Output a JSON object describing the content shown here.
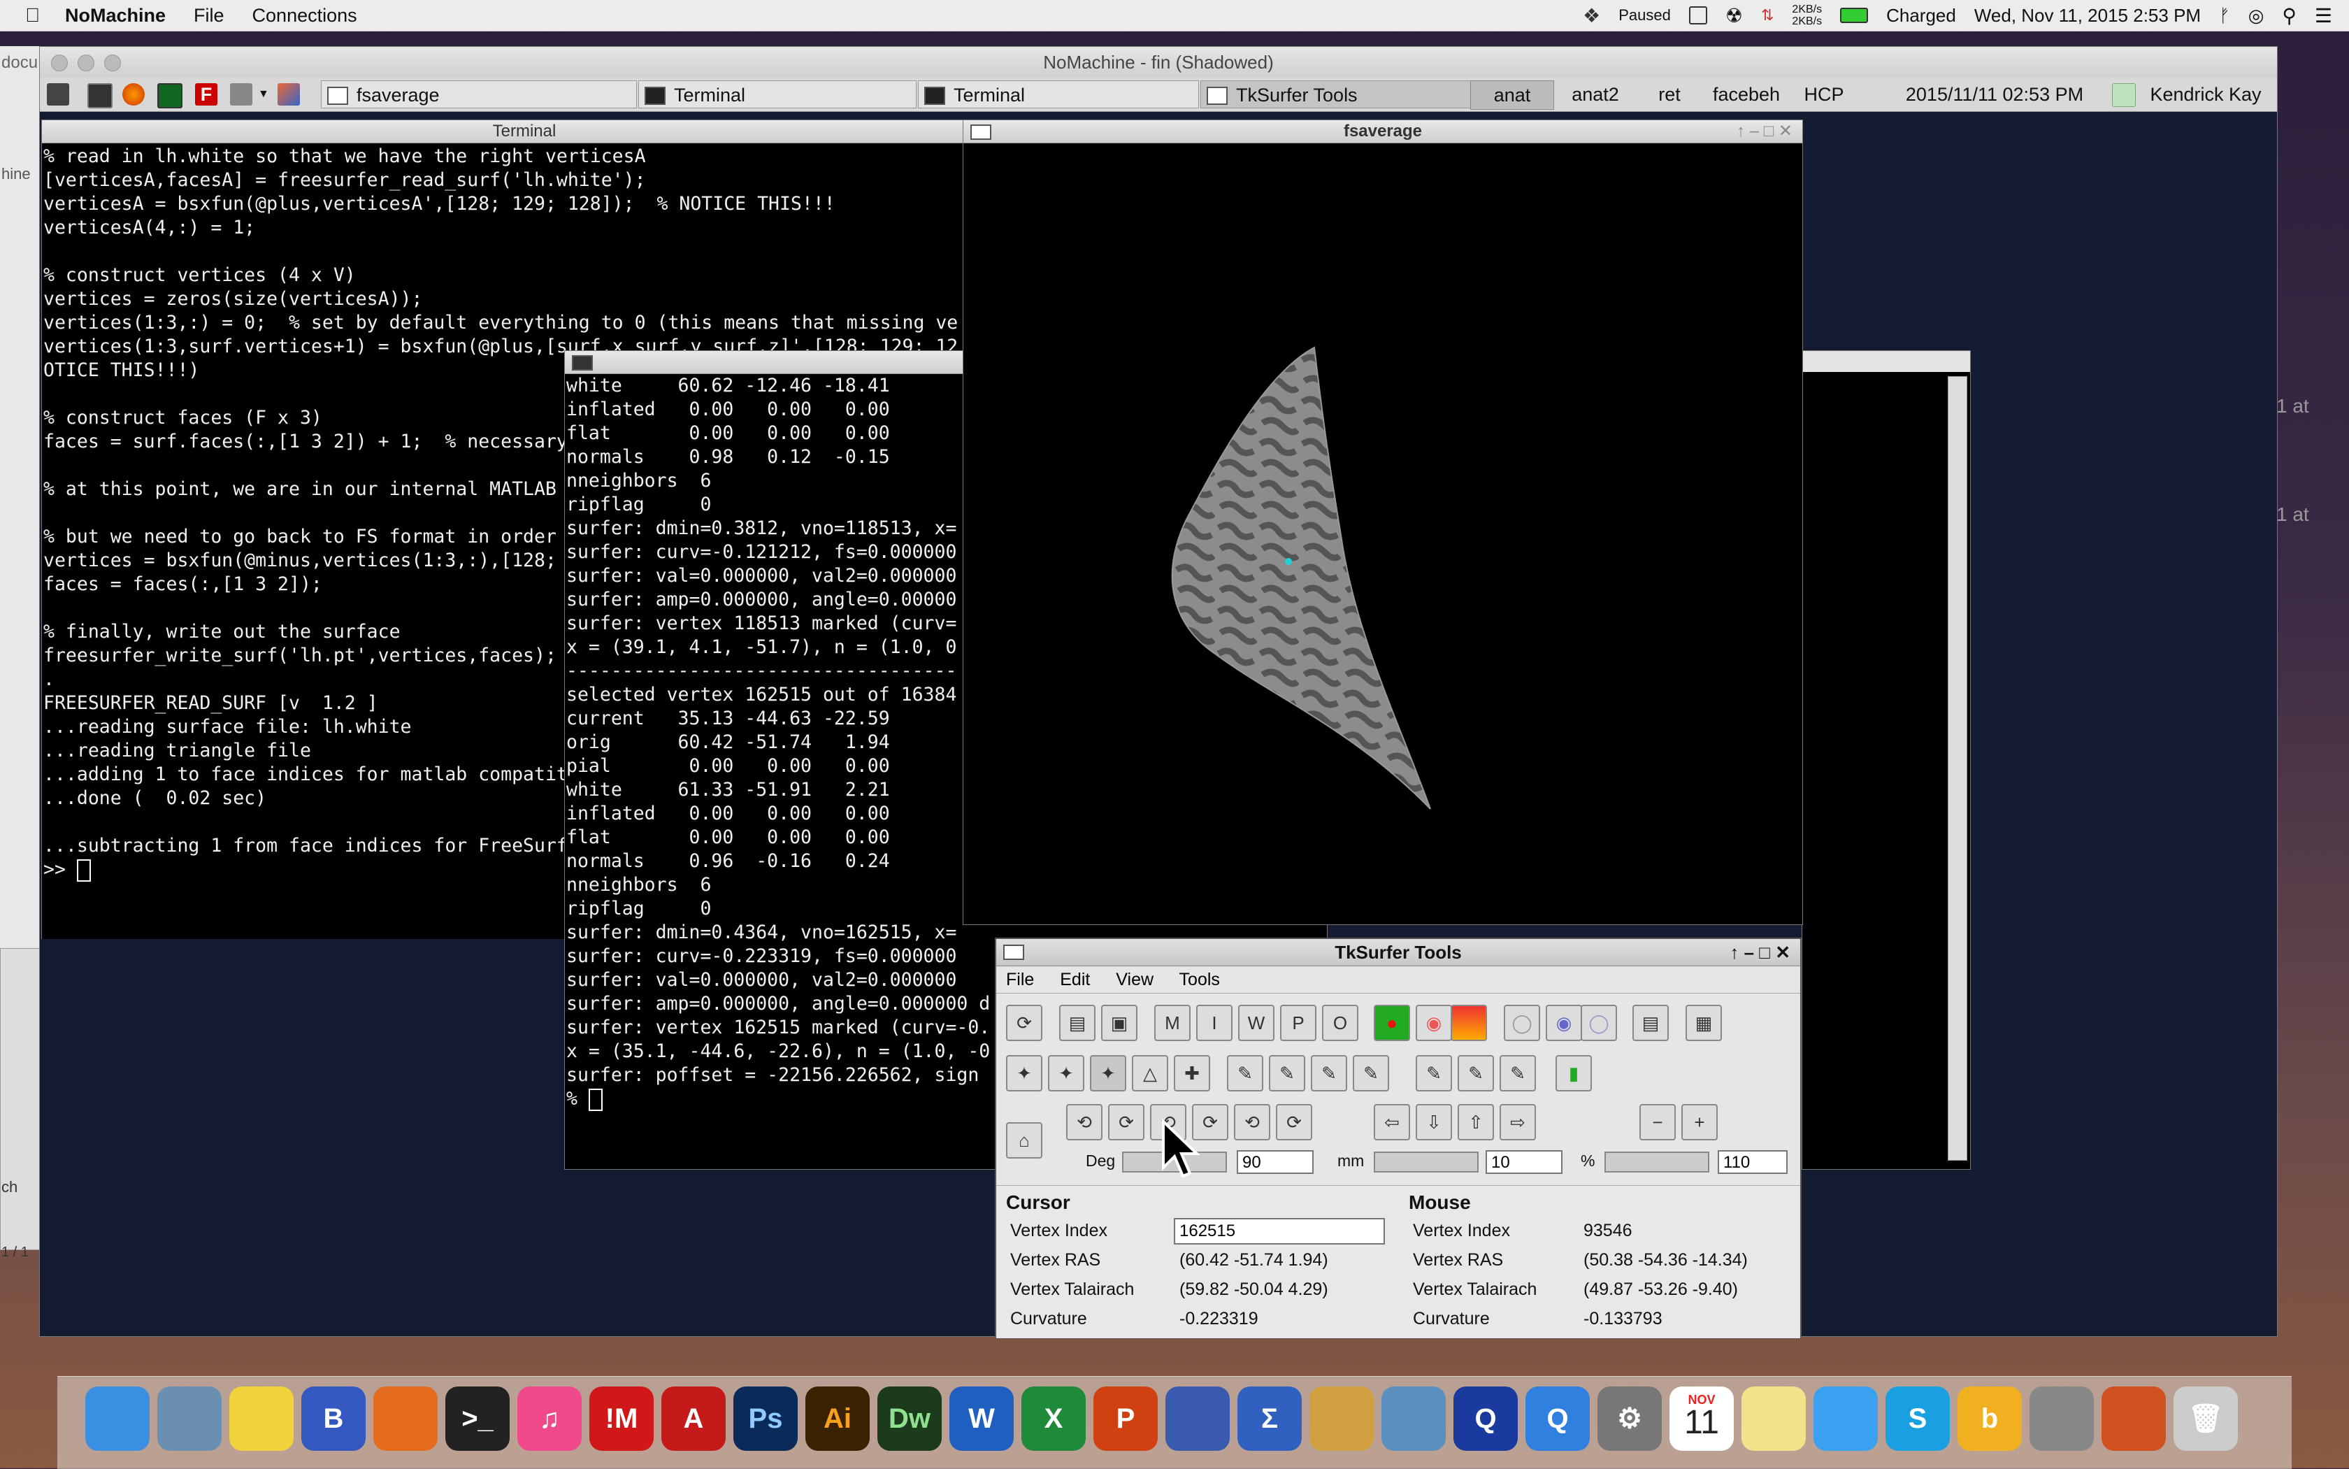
{
  "menubar": {
    "app": "NoMachine",
    "items": [
      "File",
      "Connections"
    ],
    "status_paused": "Paused",
    "net_up": "2KB/s",
    "net_down": "2KB/s",
    "battery": "Charged",
    "datetime": "Wed, Nov 11, 2015  2:53 PM"
  },
  "nomachine": {
    "title": "NoMachine - fin (Shadowed)",
    "taskbar": {
      "tasks": [
        "fsaverage",
        "Terminal",
        "Terminal",
        "TkSurfer Tools"
      ],
      "workspaces": [
        "anat",
        "anat2",
        "ret",
        "facebeh",
        "HCP"
      ],
      "clock": "2015/11/11  02:53 PM",
      "user": "Kendrick Kay"
    }
  },
  "terminal1": {
    "title": "Terminal",
    "lines": [
      "% read in lh.white so that we have the right verticesA",
      "[verticesA,facesA] = freesurfer_read_surf('lh.white');",
      "verticesA = bsxfun(@plus,verticesA',[128; 129; 128]);  % NOTICE THIS!!!",
      "verticesA(4,:) = 1;",
      "",
      "% construct vertices (4 x V)",
      "vertices = zeros(size(verticesA));",
      "vertices(1:3,:) = 0;  % set by default everything to 0 (this means that missing ve",
      "vertices(1:3,surf.vertices+1) = bsxfun(@plus,[surf.x surf.y surf.z]',[128; 129; 12",
      "OTICE THIS!!!)",
      "",
      "% construct faces (F x 3)",
      "faces = surf.faces(:,[1 3 2]) + 1;  % necessary",
      "",
      "% at this point, we are in our internal MATLAB",
      "",
      "% but we need to go back to FS format in order",
      "vertices = bsxfun(@minus,vertices(1:3,:),[128;",
      "faces = faces(:,[1 3 2]);",
      "",
      "% finally, write out the surface",
      "freesurfer_write_surf('lh.pt',vertices,faces);",
      ".",
      "FREESURFER_READ_SURF [v  1.2 ]",
      "...reading surface file: lh.white",
      "...reading triangle file",
      "...adding 1 to face indices for matlab compatit",
      "...done (  0.02 sec)",
      "",
      "...subtracting 1 from face indices for FreeSurf",
      ">> "
    ]
  },
  "terminal2": {
    "lines": [
      "white     60.62 -12.46 -18.41",
      "inflated   0.00   0.00   0.00",
      "flat       0.00   0.00   0.00",
      "normals    0.98   0.12  -0.15",
      "nneighbors  6",
      "ripflag     0",
      "surfer: dmin=0.3812, vno=118513, x=",
      "surfer: curv=-0.121212, fs=0.000000",
      "surfer: val=0.000000, val2=0.000000",
      "surfer: amp=0.000000, angle=0.00000",
      "surfer: vertex 118513 marked (curv=",
      "x = (39.1, 4.1, -51.7), n = (1.0, 0",
      "-----------------------------------",
      "selected vertex 162515 out of 16384",
      "current   35.13 -44.63 -22.59",
      "orig      60.42 -51.74   1.94",
      "pial       0.00   0.00   0.00",
      "white     61.33 -51.91   2.21",
      "inflated   0.00   0.00   0.00",
      "flat       0.00   0.00   0.00",
      "normals    0.96  -0.16   0.24",
      "nneighbors  6",
      "ripflag     0",
      "surfer: dmin=0.4364, vno=162515, x=",
      "surfer: curv=-0.223319, fs=0.000000",
      "surfer: val=0.000000, val2=0.000000",
      "surfer: amp=0.000000, angle=0.000000 d",
      "surfer: vertex 162515 marked (curv=-0.",
      "x = (35.1, -44.6, -22.6), n = (1.0, -0",
      "surfer: poffset = -22156.226562, sign",
      "% "
    ]
  },
  "fsaverage": {
    "title": "fsaverage"
  },
  "tksurfer": {
    "title": "TkSurfer Tools",
    "menus": [
      "File",
      "Edit",
      "View",
      "Tools"
    ],
    "deg_label": "Deg",
    "deg_value": "90",
    "mm_label": "mm",
    "mm_value": "10",
    "pct_label": "%",
    "pct_value": "110",
    "cursor": {
      "heading": "Cursor",
      "vertex_index_label": "Vertex Index",
      "vertex_index": "162515",
      "vertex_ras_label": "Vertex RAS",
      "vertex_ras": "(60.42  -51.74  1.94)",
      "talairach_label": "Vertex Talairach",
      "talairach": "(59.82  -50.04  4.29)",
      "curvature_label": "Curvature",
      "curvature": "-0.223319"
    },
    "mouse": {
      "heading": "Mouse",
      "vertex_index_label": "Vertex Index",
      "vertex_index": "93546",
      "vertex_ras_label": "Vertex RAS",
      "vertex_ras": "(50.38  -54.36  -14.34)",
      "talairach_label": "Vertex Talairach",
      "talairach": "(49.87  -53.26  -9.40)",
      "curvature_label": "Curvature",
      "curvature": "-0.133793"
    }
  },
  "side_fragments": {
    "right_top": "1 at",
    "right_bottom": "1 at",
    "left_a": "docu",
    "left_b": "hine",
    "left_c": "ch",
    "left_d": "1 / 1"
  },
  "dock": {
    "calendar_month": "NOV",
    "calendar_day": "11",
    "apps": [
      "Finder",
      "Preview",
      "Stickies",
      "BBEdit",
      "Firefox",
      "Terminal",
      "iTunes",
      "Mail",
      "Acrobat",
      "Ps",
      "Ai",
      "Dw",
      "Word",
      "Excel",
      "PowerPoint",
      "Migration",
      "Sigma",
      "Transmit",
      "Preview2",
      "QuickTime",
      "QuickTime2",
      "System Preferences",
      "Calendar",
      "Notes",
      "Messages",
      "Skype",
      "Bing",
      "Network",
      "MATLAB",
      "Trash"
    ]
  }
}
